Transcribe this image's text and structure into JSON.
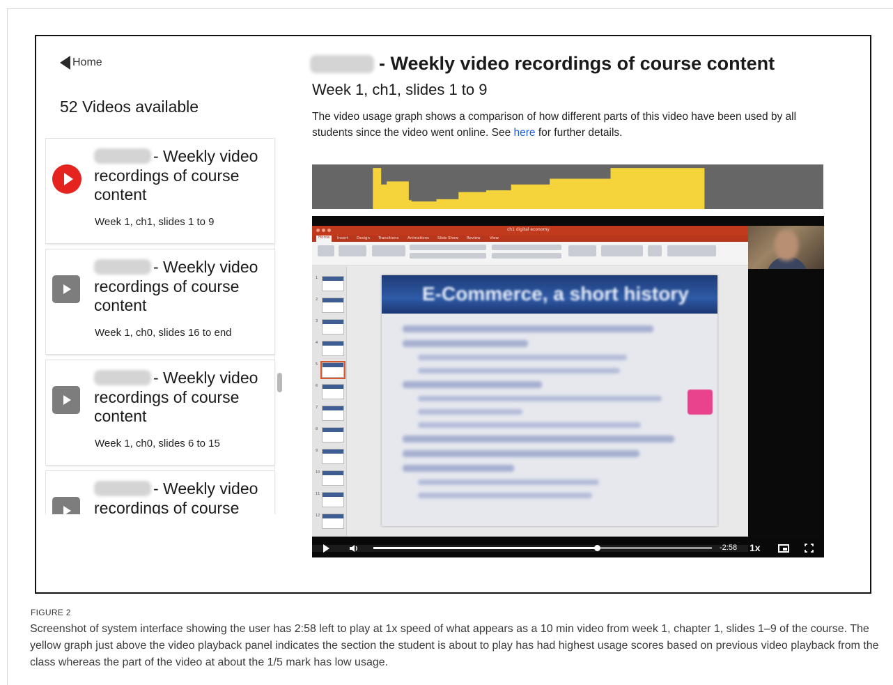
{
  "nav": {
    "home_label": "Home"
  },
  "sidebar": {
    "video_count": "52 Videos available",
    "videos": [
      {
        "title": "- Weekly video recordings of course content",
        "subtitle": "Week 1, ch1, slides 1 to 9",
        "state": "playing"
      },
      {
        "title": "- Weekly video recordings of course content",
        "subtitle": "Week 1, ch0, slides 16 to end",
        "state": "idle"
      },
      {
        "title": "- Weekly video recordings of course content",
        "subtitle": "Week 1, ch0, slides 6 to 15",
        "state": "idle"
      },
      {
        "title": "- Weekly video recordings of course",
        "subtitle": "",
        "state": "idle"
      }
    ]
  },
  "main": {
    "course_title": "- Weekly video recordings of course content",
    "video_title": "Week 1, ch1, slides 1 to 9",
    "description_before_link": "The video usage graph shows a comparison of how different parts of this video have been used by all students since the video went online. See ",
    "description_link": "here",
    "description_after_link": " for further details."
  },
  "usage_graph": {
    "colors": {
      "background": "#666666",
      "fill": "#f4d33b"
    },
    "usage_levels": [
      0,
      0,
      0,
      0,
      0,
      0,
      0,
      0,
      0,
      0,
      0,
      0,
      0,
      0,
      0,
      0,
      0,
      0,
      0,
      0,
      0,
      0,
      0.92,
      0.92,
      0.92,
      0.55,
      0.55,
      0.62,
      0.62,
      0.62,
      0.62,
      0.62,
      0.62,
      0.62,
      0.62,
      0.2,
      0.17,
      0.17,
      0.17,
      0.17,
      0.17,
      0.17,
      0.17,
      0.17,
      0.17,
      0.22,
      0.22,
      0.22,
      0.22,
      0.22,
      0.22,
      0.22,
      0.22,
      0.38,
      0.38,
      0.38,
      0.38,
      0.38,
      0.38,
      0.38,
      0.38,
      0.38,
      0.38,
      0.42,
      0.42,
      0.42,
      0.42,
      0.42,
      0.42,
      0.42,
      0.42,
      0.42,
      0.55,
      0.55,
      0.55,
      0.55,
      0.55,
      0.55,
      0.55,
      0.55,
      0.55,
      0.55,
      0.55,
      0.55,
      0.55,
      0.55,
      0.68,
      0.68,
      0.68,
      0.68,
      0.68,
      0.68,
      0.68,
      0.68,
      0.68,
      0.68,
      0.68,
      0.68,
      0.68,
      0.68,
      0.68,
      0.68,
      0.68,
      0.68,
      0.68,
      0.68,
      0.68,
      0.68,
      0.92,
      0.92,
      0.92,
      0.92,
      0.92,
      0.92,
      0.92,
      0.92,
      0.92,
      0.92,
      0.92,
      0.92,
      0.92,
      0.92,
      0.92,
      0.92,
      0.92,
      0.92,
      0.92,
      0.92,
      0.92,
      0.92,
      0.92,
      0.92,
      0.92,
      0.92,
      0.92,
      0.92,
      0.92,
      0.92,
      0.92,
      0.92,
      0.92,
      0.92,
      0,
      0,
      0,
      0,
      0,
      0,
      0,
      0,
      0,
      0,
      0,
      0,
      0,
      0,
      0,
      0,
      0,
      0,
      0,
      0,
      0,
      0,
      0,
      0,
      0,
      0,
      0,
      0,
      0,
      0,
      0,
      0,
      0,
      0,
      0,
      0,
      0,
      0,
      0,
      0,
      0,
      0,
      0
    ]
  },
  "slide": {
    "title": "E-Commerce, a short history",
    "file_name": "ch1 digital economy",
    "ribbon_tabs": [
      "Home",
      "Insert",
      "Design",
      "Transitions",
      "Animations",
      "Slide Show",
      "Review",
      "View"
    ]
  },
  "player": {
    "progress": 0.66,
    "time_remaining": "-2:58",
    "speed": "1x"
  },
  "figure": {
    "label": "FIGURE 2",
    "caption": "Screenshot of system interface showing the user has 2:58 left to play at 1x speed of what appears as a 10 min video from week 1, chapter 1, slides 1–9 of the course. The yellow graph just above the video playback panel indicates the section the student is about to play has had highest usage scores based on previous video playback from the class whereas the part of the video at about the 1/5 mark has low usage."
  }
}
